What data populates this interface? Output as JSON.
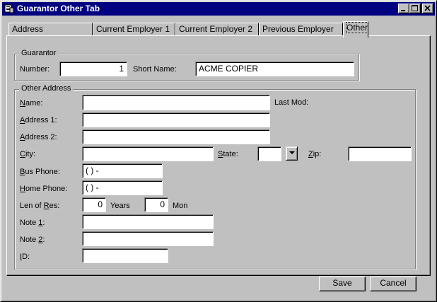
{
  "window": {
    "title": "Guarantor Other Tab"
  },
  "tabs": [
    {
      "label": "Address"
    },
    {
      "label": "Current Employer 1"
    },
    {
      "label": "Current Employer 2"
    },
    {
      "label": "Previous Employer"
    },
    {
      "label": "Other",
      "active": true
    }
  ],
  "guarantor": {
    "group_title": "Guarantor",
    "number_label": "Number:",
    "number_value": "1",
    "short_name_label": "Short Name:",
    "short_name_value": "ACME COPIER"
  },
  "other_address": {
    "group_title": "Other Address",
    "name_label": "Name:",
    "name_value": "",
    "last_mod_label": "Last Mod:",
    "address1_label": "Address 1:",
    "address1_value": "",
    "address2_label": "Address 2:",
    "address2_value": "",
    "city_label": "City:",
    "city_value": "",
    "state_label": "State:",
    "state_value": "",
    "zip_label": "Zip:",
    "zip_value": "",
    "bus_phone_label": "Bus Phone:",
    "bus_phone_value": "(  )  -",
    "home_phone_label": "Home Phone:",
    "home_phone_value": "(  )  -",
    "len_of_res_label": "Len of Res:",
    "years_value": "0",
    "years_label": "Years",
    "months_value": "0",
    "months_label": "Mon",
    "note1_label": "Note 1:",
    "note1_value": "",
    "note2_label": "Note 2:",
    "note2_value": "",
    "id_label": "ID:",
    "id_value": ""
  },
  "buttons": {
    "save": "Save",
    "cancel": "Cancel"
  },
  "icons": {
    "app": "app-icon",
    "minimize": "minimize-icon",
    "maximize": "maximize-icon",
    "close": "close-icon",
    "dropdown": "chevron-down-icon"
  },
  "colors": {
    "titlebar": "#000080",
    "face": "#c0c0c0",
    "field": "#ffffff"
  }
}
